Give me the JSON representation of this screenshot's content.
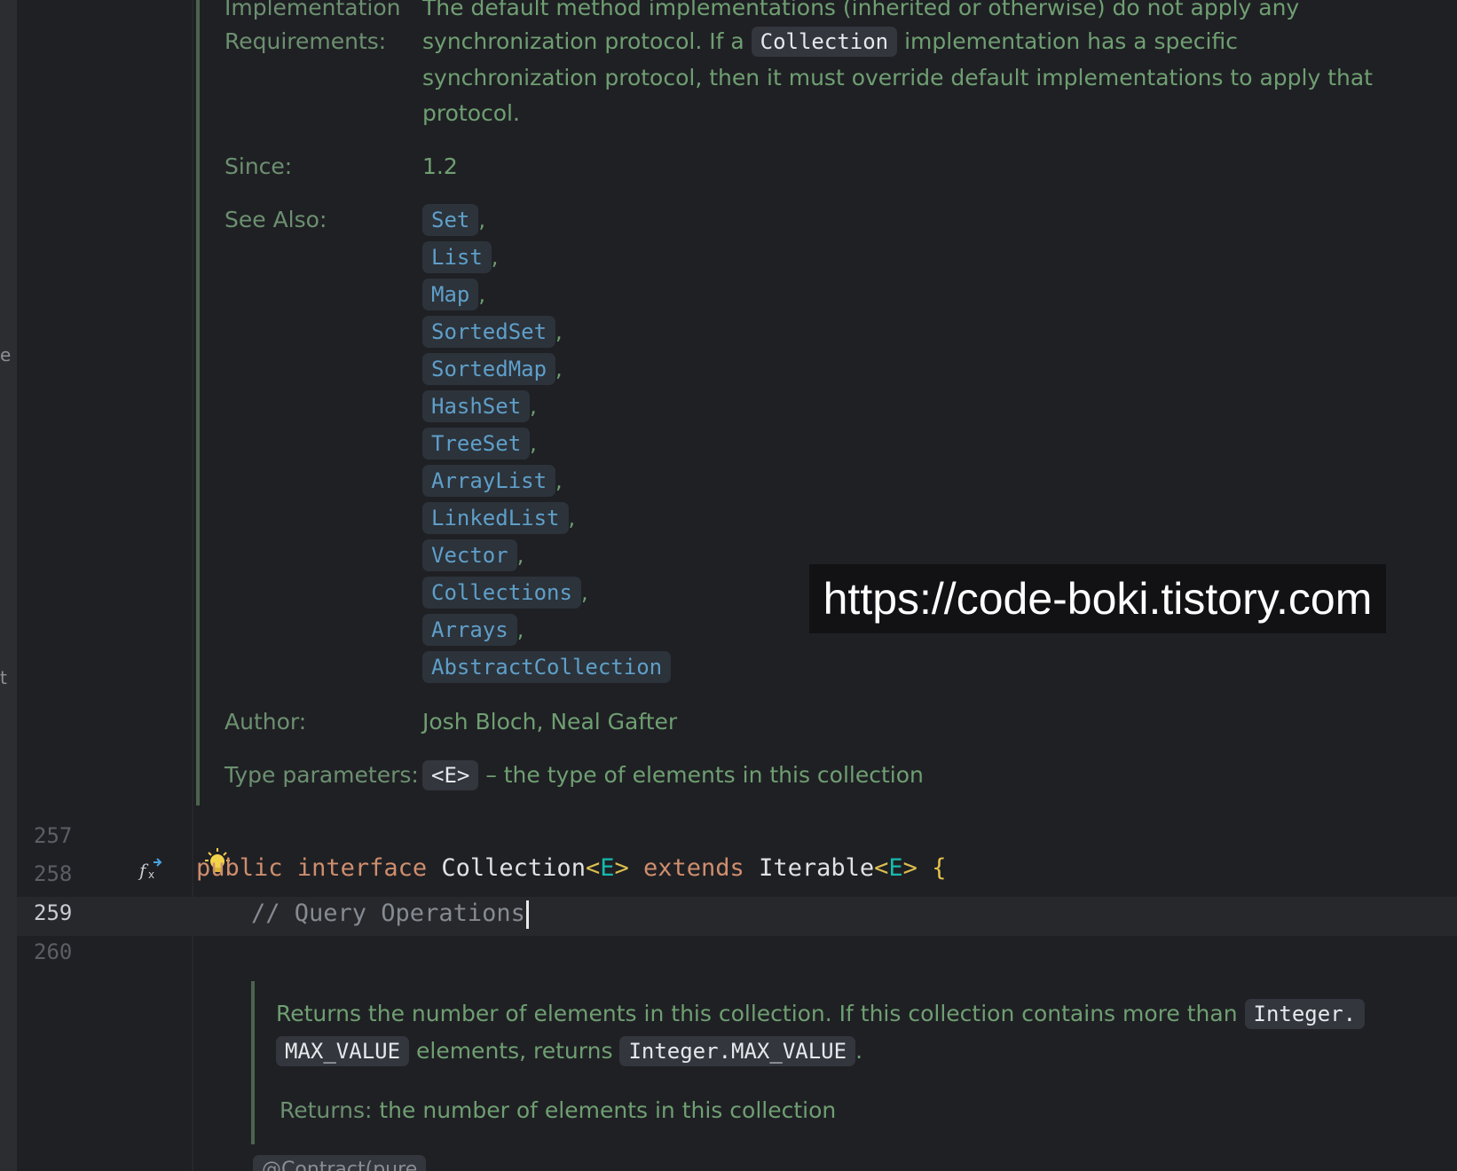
{
  "doc_top": {
    "impl_req_label_1": "Implementation",
    "impl_req_label_2": "Requirements:",
    "impl_req_line1": "The default method implementations (inherited or otherwise) do not apply any",
    "impl_req_line2_pre": "synchronization protocol. If a",
    "impl_req_line2_code": "Collection",
    "impl_req_line2_post": "implementation has a specific",
    "impl_req_line3": "synchronization protocol, then it must override default implementations to apply that",
    "impl_req_line4": "protocol.",
    "since_label": "Since:",
    "since_value": "1.2",
    "see_also_label": "See Also:",
    "see_also": [
      "Set",
      "List",
      "Map",
      "SortedSet",
      "SortedMap",
      "HashSet",
      "TreeSet",
      "ArrayList",
      "LinkedList",
      "Vector",
      "Collections",
      "Arrays",
      "AbstractCollection"
    ],
    "comma": ",",
    "author_label": "Author:",
    "author_value": "Josh Bloch, Neal Gafter",
    "type_params_label": "Type parameters:",
    "type_params_code": "<E>",
    "type_params_desc": "– the type of elements in this collection"
  },
  "editor": {
    "line_numbers": [
      "257",
      "258",
      "259",
      "260"
    ],
    "gutter_icon": "implemented-method-icon",
    "intention_icon": "lightbulb-icon",
    "line258": {
      "kw_public": "public",
      "kw_interface": "interface",
      "name": "Collection",
      "lt1": "<",
      "tp1": "E",
      "gt1": ">",
      "kw_extends": "extends",
      "iter": "Iterable",
      "lt2": "<",
      "tp2": "E",
      "gt2": ">",
      "brace": "{"
    },
    "line259_comment": "// Query Operations"
  },
  "doc_bottom": {
    "line1_pre": "Returns the number of elements in this collection. If this collection contains more than",
    "line1_code": "Integer.",
    "line2_code1": "MAX_VALUE",
    "line2_mid": "elements, returns",
    "line2_code2": "Integer.MAX_VALUE",
    "line2_end": ".",
    "returns_label": "Returns:",
    "returns_value": "the number of elements in this collection",
    "annotation_partial": "@Contract(pure = true)"
  },
  "watermark": "https://code-boki.tistory.com",
  "sidebar_glyphs": [
    "e",
    "t"
  ]
}
